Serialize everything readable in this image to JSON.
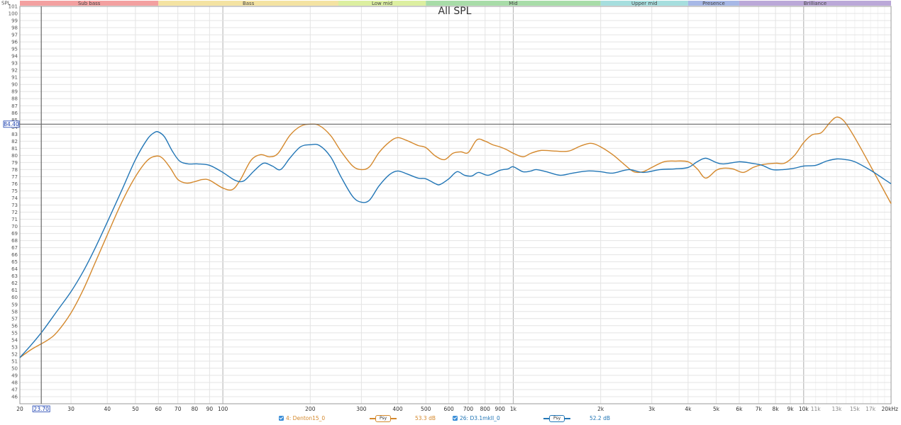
{
  "chart_data": {
    "type": "line",
    "title": "All SPL",
    "y_axis_title": "SPL",
    "x_scale": "log",
    "xlim": [
      20,
      20000
    ],
    "ylim": [
      45,
      101
    ],
    "y_ticks": [
      46,
      47,
      48,
      49,
      50,
      51,
      52,
      53,
      54,
      55,
      56,
      57,
      58,
      59,
      60,
      61,
      62,
      63,
      64,
      65,
      66,
      67,
      68,
      69,
      70,
      71,
      72,
      73,
      74,
      75,
      76,
      77,
      78,
      79,
      80,
      81,
      82,
      83,
      84,
      85,
      86,
      87,
      88,
      89,
      90,
      91,
      92,
      93,
      94,
      95,
      96,
      97,
      98,
      99,
      100,
      101
    ],
    "x_ticks": [
      {
        "value": 20,
        "label": "20",
        "dim": false
      },
      {
        "value": 30,
        "label": "30",
        "dim": false
      },
      {
        "value": 40,
        "label": "40",
        "dim": false
      },
      {
        "value": 50,
        "label": "50",
        "dim": false
      },
      {
        "value": 60,
        "label": "60",
        "dim": false
      },
      {
        "value": 70,
        "label": "70",
        "dim": false
      },
      {
        "value": 80,
        "label": "80",
        "dim": false
      },
      {
        "value": 90,
        "label": "90",
        "dim": false
      },
      {
        "value": 100,
        "label": "100",
        "dim": false
      },
      {
        "value": 200,
        "label": "200",
        "dim": false
      },
      {
        "value": 300,
        "label": "300",
        "dim": false
      },
      {
        "value": 400,
        "label": "400",
        "dim": false
      },
      {
        "value": 500,
        "label": "500",
        "dim": false
      },
      {
        "value": 600,
        "label": "600",
        "dim": false
      },
      {
        "value": 700,
        "label": "700",
        "dim": false
      },
      {
        "value": 800,
        "label": "800",
        "dim": false
      },
      {
        "value": 900,
        "label": "900",
        "dim": false
      },
      {
        "value": 1000,
        "label": "1k",
        "dim": false
      },
      {
        "value": 2000,
        "label": "2k",
        "dim": false
      },
      {
        "value": 3000,
        "label": "3k",
        "dim": false
      },
      {
        "value": 4000,
        "label": "4k",
        "dim": false
      },
      {
        "value": 5000,
        "label": "5k",
        "dim": false
      },
      {
        "value": 6000,
        "label": "6k",
        "dim": false
      },
      {
        "value": 7000,
        "label": "7k",
        "dim": false
      },
      {
        "value": 8000,
        "label": "8k",
        "dim": false
      },
      {
        "value": 9000,
        "label": "9k",
        "dim": false
      },
      {
        "value": 10000,
        "label": "10k",
        "dim": false
      },
      {
        "value": 11000,
        "label": "11k",
        "dim": true
      },
      {
        "value": 13000,
        "label": "13k",
        "dim": true
      },
      {
        "value": 15000,
        "label": "15k",
        "dim": true
      },
      {
        "value": 17000,
        "label": "17k",
        "dim": true
      },
      {
        "value": 20000,
        "label": "20kHz",
        "dim": false
      }
    ],
    "bands": [
      {
        "label": "Sub bass",
        "from": 20,
        "to": 60,
        "color": "#f3a0a0"
      },
      {
        "label": "Bass",
        "from": 60,
        "to": 250,
        "color": "#f4e3a2"
      },
      {
        "label": "Low mid",
        "from": 250,
        "to": 500,
        "color": "#dcefa0"
      },
      {
        "label": "Mid",
        "from": 500,
        "to": 2000,
        "color": "#a8dca8"
      },
      {
        "label": "Upper mid",
        "from": 2000,
        "to": 4000,
        "color": "#a6dede"
      },
      {
        "label": "Presence",
        "from": 4000,
        "to": 6000,
        "color": "#a7b8e6"
      },
      {
        "label": "Brilliance",
        "from": 6000,
        "to": 20000,
        "color": "#bba8d8"
      }
    ],
    "cursor": {
      "x": 23.7,
      "y": 84.4,
      "x_label": "23.70",
      "y_label": "84.40"
    },
    "grid": true,
    "legend_position": "bottom",
    "series": [
      {
        "name": "4: Denton15_0",
        "color": "#d4882c",
        "smoothing": "Psy",
        "level": "53.3 dB",
        "points": [
          [
            20,
            51.5
          ],
          [
            22,
            52.7
          ],
          [
            25,
            54.0
          ],
          [
            27,
            55.2
          ],
          [
            30,
            57.8
          ],
          [
            33,
            61.0
          ],
          [
            36,
            64.5
          ],
          [
            40,
            68.8
          ],
          [
            45,
            73.5
          ],
          [
            50,
            77.0
          ],
          [
            55,
            79.3
          ],
          [
            59,
            79.9
          ],
          [
            62,
            79.6
          ],
          [
            66,
            78.2
          ],
          [
            70,
            76.6
          ],
          [
            75,
            76.1
          ],
          [
            80,
            76.3
          ],
          [
            85,
            76.6
          ],
          [
            90,
            76.5
          ],
          [
            100,
            75.4
          ],
          [
            108,
            75.2
          ],
          [
            115,
            76.6
          ],
          [
            125,
            79.3
          ],
          [
            135,
            80.1
          ],
          [
            145,
            79.8
          ],
          [
            155,
            80.3
          ],
          [
            170,
            82.8
          ],
          [
            185,
            84.1
          ],
          [
            200,
            84.4
          ],
          [
            215,
            84.2
          ],
          [
            235,
            82.8
          ],
          [
            255,
            80.6
          ],
          [
            280,
            78.5
          ],
          [
            300,
            78.0
          ],
          [
            320,
            78.4
          ],
          [
            345,
            80.4
          ],
          [
            375,
            81.9
          ],
          [
            400,
            82.5
          ],
          [
            430,
            82.1
          ],
          [
            470,
            81.4
          ],
          [
            500,
            81.1
          ],
          [
            540,
            79.9
          ],
          [
            580,
            79.4
          ],
          [
            620,
            80.3
          ],
          [
            660,
            80.5
          ],
          [
            700,
            80.4
          ],
          [
            750,
            82.2
          ],
          [
            800,
            82.0
          ],
          [
            850,
            81.5
          ],
          [
            900,
            81.2
          ],
          [
            950,
            80.8
          ],
          [
            1000,
            80.3
          ],
          [
            1080,
            79.8
          ],
          [
            1150,
            80.3
          ],
          [
            1250,
            80.7
          ],
          [
            1400,
            80.6
          ],
          [
            1550,
            80.6
          ],
          [
            1700,
            81.3
          ],
          [
            1850,
            81.7
          ],
          [
            2000,
            81.2
          ],
          [
            2200,
            80.1
          ],
          [
            2400,
            78.8
          ],
          [
            2600,
            77.7
          ],
          [
            2800,
            77.7
          ],
          [
            3000,
            78.3
          ],
          [
            3300,
            79.1
          ],
          [
            3600,
            79.2
          ],
          [
            4000,
            79.1
          ],
          [
            4300,
            78.1
          ],
          [
            4600,
            76.8
          ],
          [
            5000,
            77.9
          ],
          [
            5300,
            78.2
          ],
          [
            5700,
            78.1
          ],
          [
            6200,
            77.6
          ],
          [
            6700,
            78.3
          ],
          [
            7200,
            78.7
          ],
          [
            8000,
            78.9
          ],
          [
            8600,
            78.9
          ],
          [
            9300,
            80.0
          ],
          [
            10000,
            81.8
          ],
          [
            10700,
            82.9
          ],
          [
            11500,
            83.2
          ],
          [
            12300,
            84.6
          ],
          [
            13000,
            85.4
          ],
          [
            13800,
            84.8
          ],
          [
            15000,
            82.5
          ],
          [
            17000,
            78.5
          ],
          [
            20000,
            73.2
          ]
        ]
      },
      {
        "name": "26: D3.1mkII_0",
        "color": "#2276b6",
        "smoothing": "Psy",
        "level": "52.2 dB",
        "points": [
          [
            20,
            51.5
          ],
          [
            22,
            53.4
          ],
          [
            24,
            55.3
          ],
          [
            27,
            58.2
          ],
          [
            30,
            60.8
          ],
          [
            33,
            63.6
          ],
          [
            36,
            66.6
          ],
          [
            40,
            70.6
          ],
          [
            45,
            75.2
          ],
          [
            50,
            79.4
          ],
          [
            55,
            82.3
          ],
          [
            58,
            83.2
          ],
          [
            60,
            83.3
          ],
          [
            63,
            82.6
          ],
          [
            67,
            80.6
          ],
          [
            71,
            79.2
          ],
          [
            76,
            78.8
          ],
          [
            82,
            78.8
          ],
          [
            90,
            78.6
          ],
          [
            100,
            77.6
          ],
          [
            110,
            76.5
          ],
          [
            118,
            76.4
          ],
          [
            128,
            77.8
          ],
          [
            138,
            78.9
          ],
          [
            148,
            78.5
          ],
          [
            158,
            78.0
          ],
          [
            170,
            79.6
          ],
          [
            185,
            81.2
          ],
          [
            200,
            81.5
          ],
          [
            215,
            81.4
          ],
          [
            235,
            79.8
          ],
          [
            255,
            77.0
          ],
          [
            280,
            74.2
          ],
          [
            300,
            73.4
          ],
          [
            320,
            73.7
          ],
          [
            345,
            75.7
          ],
          [
            375,
            77.3
          ],
          [
            400,
            77.8
          ],
          [
            430,
            77.4
          ],
          [
            470,
            76.8
          ],
          [
            500,
            76.7
          ],
          [
            540,
            76.0
          ],
          [
            560,
            75.9
          ],
          [
            600,
            76.7
          ],
          [
            640,
            77.7
          ],
          [
            680,
            77.2
          ],
          [
            720,
            77.1
          ],
          [
            760,
            77.6
          ],
          [
            820,
            77.2
          ],
          [
            900,
            77.9
          ],
          [
            960,
            78.1
          ],
          [
            1000,
            78.4
          ],
          [
            1080,
            77.7
          ],
          [
            1150,
            77.8
          ],
          [
            1200,
            78.0
          ],
          [
            1300,
            77.7
          ],
          [
            1450,
            77.2
          ],
          [
            1600,
            77.5
          ],
          [
            1800,
            77.8
          ],
          [
            2000,
            77.7
          ],
          [
            2200,
            77.5
          ],
          [
            2500,
            78.0
          ],
          [
            2800,
            77.6
          ],
          [
            3200,
            78.0
          ],
          [
            3600,
            78.1
          ],
          [
            4000,
            78.3
          ],
          [
            4300,
            79.1
          ],
          [
            4600,
            79.6
          ],
          [
            5000,
            79.0
          ],
          [
            5300,
            78.8
          ],
          [
            6000,
            79.1
          ],
          [
            6600,
            78.9
          ],
          [
            7200,
            78.6
          ],
          [
            7800,
            78.0
          ],
          [
            8500,
            78.0
          ],
          [
            9300,
            78.2
          ],
          [
            10000,
            78.5
          ],
          [
            11000,
            78.6
          ],
          [
            12000,
            79.2
          ],
          [
            13000,
            79.5
          ],
          [
            14000,
            79.4
          ],
          [
            15000,
            79.1
          ],
          [
            17000,
            77.9
          ],
          [
            19000,
            76.6
          ],
          [
            20000,
            76.0
          ]
        ]
      }
    ]
  },
  "legend": {
    "items": [
      {
        "label": "4: Denton15_0",
        "psy": "Psy",
        "level": "53.3 dB",
        "color": "#d4882c",
        "check_color": "#3b8ed8"
      },
      {
        "label": "26: D3.1mkII_0",
        "psy": "Psy",
        "level": "52.2 dB",
        "color": "#2276b6",
        "check_color": "#3b8ed8"
      }
    ]
  }
}
